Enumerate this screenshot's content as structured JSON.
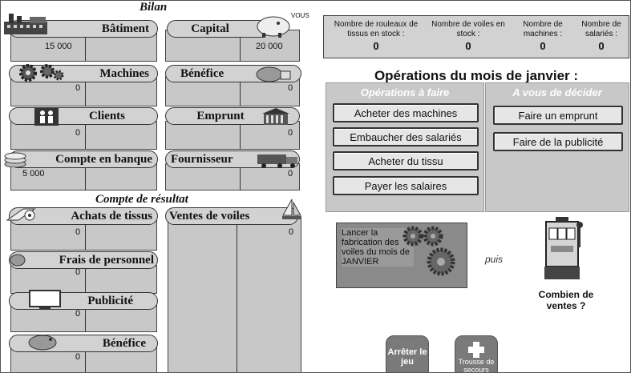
{
  "bilan": {
    "title": "Bilan",
    "vous_label": "VOUS",
    "batiment": {
      "label": "Bâtiment",
      "left_value": "15 000",
      "right_value": ""
    },
    "capital": {
      "label": "Capital",
      "left_value": "",
      "right_value": "20 000"
    },
    "machines": {
      "label": "Machines",
      "left_value": "0",
      "right_value": ""
    },
    "benefice": {
      "label": "Bénéfice",
      "left_value": "",
      "right_value": "0"
    },
    "clients": {
      "label": "Clients",
      "left_value": "0",
      "right_value": ""
    },
    "emprunt": {
      "label": "Emprunt",
      "left_value": "",
      "right_value": "0"
    },
    "compte_banque": {
      "label": "Compte en banque",
      "left_value": "5 000",
      "right_value": ""
    },
    "fournisseur": {
      "label": "Fournisseur",
      "left_value": "",
      "right_value": "0"
    }
  },
  "resultat": {
    "title": "Compte de résultat",
    "achats_tissus": {
      "label": "Achats de tissus",
      "value": "0"
    },
    "ventes_voiles": {
      "label": "Ventes de voiles",
      "value": "0"
    },
    "frais_personnel": {
      "label": "Frais de personnel",
      "value": "0"
    },
    "publicite": {
      "label": "Publicité",
      "value": "0"
    },
    "benefice": {
      "label": "Bénéfice",
      "value": "0"
    }
  },
  "stock": {
    "rouleaux": {
      "label": "Nombre de rouleaux de tissus en stock :",
      "value": "0"
    },
    "voiles": {
      "label": "Nombre de voiles en stock :",
      "value": "0"
    },
    "machines": {
      "label": "Nombre de machines :",
      "value": "0"
    },
    "salaries": {
      "label": "Nombre de salariés :",
      "value": "0"
    }
  },
  "operations": {
    "title": "Opérations du mois de janvier :",
    "a_faire_title": "Opérations à faire",
    "a_decider_title": "A vous de décider",
    "acheter_machines": "Acheter des machines",
    "embaucher": "Embaucher des salariés",
    "acheter_tissu": "Acheter du tissu",
    "payer_salaires": "Payer les salaires",
    "faire_emprunt": "Faire un emprunt",
    "faire_publicite": "Faire de la publicité"
  },
  "production": {
    "launch_text": "Lancer la fabrication des voiles du mois de JANVIER",
    "puis": "puis",
    "combien_ventes": "Combien de ventes ?"
  },
  "bottom": {
    "arreter": "Arrêter le jeu",
    "trousse": "Trousse de secours"
  },
  "colors": {
    "panel": "#c8c8c8",
    "pill": "#d2d2d2",
    "launch": "#8a8a8a",
    "round_btn": "#7a7a7a"
  }
}
